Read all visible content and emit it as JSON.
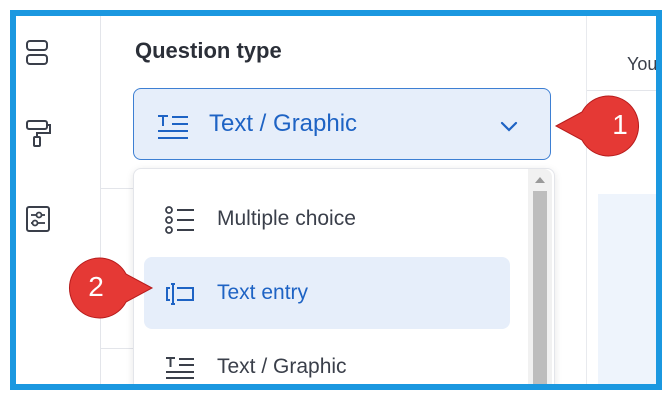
{
  "header": {
    "you_text": "You'"
  },
  "panel": {
    "heading": "Question type",
    "select": {
      "value": "Text / Graphic",
      "icon": "text-graphic-icon"
    }
  },
  "dropdown": {
    "options": [
      {
        "label": "Multiple choice",
        "icon": "list-bullets-icon",
        "selected": false
      },
      {
        "label": "Text entry",
        "icon": "text-entry-icon",
        "selected": true
      },
      {
        "label": "Text / Graphic",
        "icon": "text-graphic-icon",
        "selected": false
      }
    ]
  },
  "callouts": {
    "one": "1",
    "two": "2"
  },
  "colors": {
    "frame": "#1b98e0",
    "accent": "#1e63c4",
    "callout": "#e53935",
    "selected_bg": "#e6eefa"
  }
}
